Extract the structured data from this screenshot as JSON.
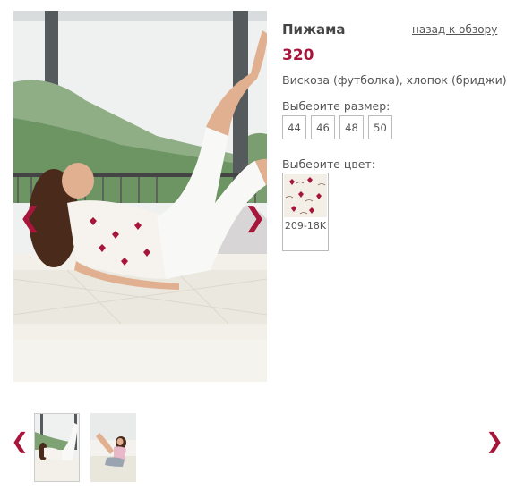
{
  "product": {
    "title": "Пижама",
    "back_link": "назад к обзору",
    "price": "320",
    "material": "Вискоза (футболка), хлопок (бриджи)"
  },
  "sizes": {
    "label": "Выберите размер:",
    "options": [
      "44",
      "46",
      "48",
      "50"
    ]
  },
  "colors": {
    "label": "Выберите цвет:",
    "options": [
      {
        "code": "209-18K"
      }
    ]
  },
  "gallery": {
    "prev_arrow": "❮",
    "next_arrow": "❯",
    "thumbnail_count": 2
  },
  "palette": {
    "accent": "#a8153a",
    "text": "#555555"
  }
}
